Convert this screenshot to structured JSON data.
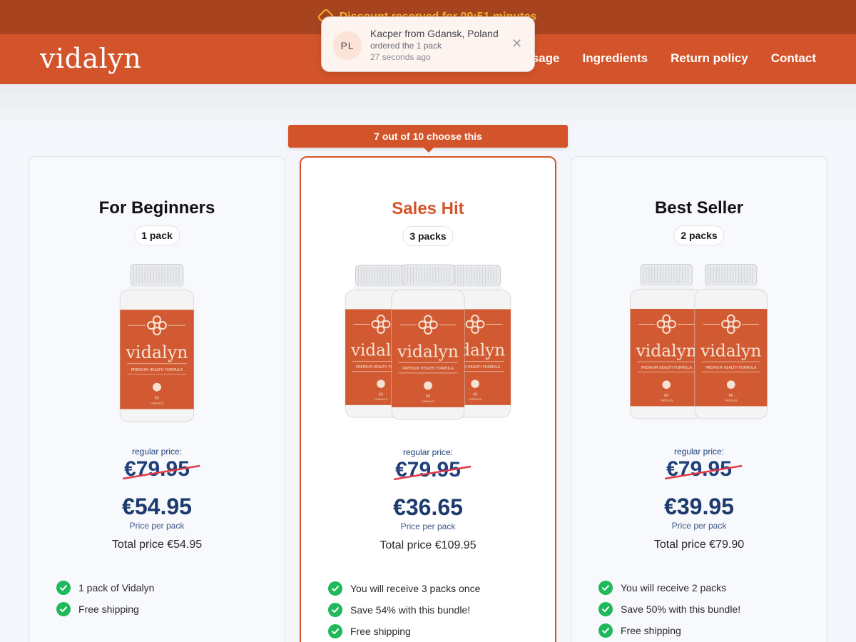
{
  "topbar": {
    "text": "Discount reserved for 09:51 minutes"
  },
  "header": {
    "logo": "vidalyn",
    "nav": [
      {
        "label": "Usage"
      },
      {
        "label": "Ingredients"
      },
      {
        "label": "Return policy"
      },
      {
        "label": "Contact"
      }
    ]
  },
  "toast": {
    "initials": "PL",
    "line1": "Kacper from Gdansk, Poland",
    "line2": "ordered the 1 pack",
    "line3": "27 seconds ago",
    "close_icon": "close-icon"
  },
  "ribbon": "7 out of 10 choose this",
  "bottle": {
    "brand": "vidalyn",
    "subtitle": "PREMIUM HEALTH FORMULA",
    "count": "60",
    "unit": "CAPSULES"
  },
  "colors": {
    "brand": "#d3542a",
    "brand_dark": "#a8431f",
    "price_navy": "#1d3a6e",
    "check_green": "#1fb85a",
    "strike_red": "#e03a47"
  },
  "cards": [
    {
      "title": "For Beginners",
      "packs": "1 pack",
      "bottle_count": 1,
      "regular_label": "regular price:",
      "old_price": "€79.95",
      "price": "€54.95",
      "per_pack": "Price per pack",
      "total": "Total price €54.95",
      "features": [
        "1 pack of Vidalyn",
        "Free shipping"
      ]
    },
    {
      "title": "Sales Hit",
      "packs": "3 packs",
      "bottle_count": 3,
      "regular_label": "regular price:",
      "old_price": "€79.95",
      "price": "€36.65",
      "per_pack": "Price per pack",
      "total": "Total price €109.95",
      "features": [
        "You will receive 3 packs once",
        "Save 54% with this bundle!",
        "Free shipping"
      ]
    },
    {
      "title": "Best Seller",
      "packs": "2 packs",
      "bottle_count": 2,
      "regular_label": "regular price:",
      "old_price": "€79.95",
      "price": "€39.95",
      "per_pack": "Price per pack",
      "total": "Total price €79.90",
      "features": [
        "You will receive 2 packs",
        "Save 50% with this bundle!",
        "Free shipping"
      ]
    }
  ]
}
